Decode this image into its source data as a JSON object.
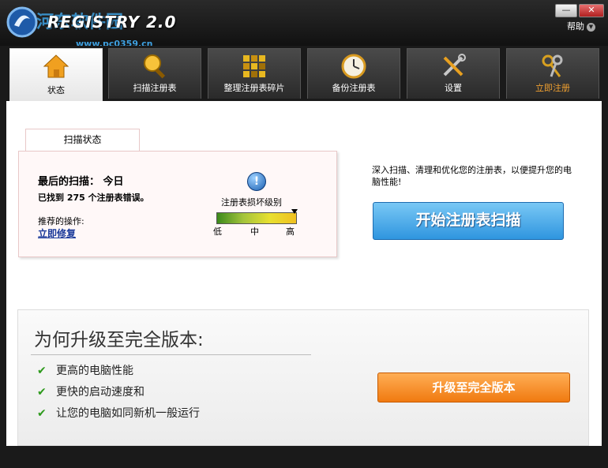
{
  "window": {
    "logo_text": "REGISTRY 2.0",
    "watermark": "河东软件园",
    "watermark_url": "www.pc0359.cn",
    "minimize_label": "—",
    "close_label": "✕",
    "help_label": "帮助"
  },
  "tabs": [
    {
      "label": "状态",
      "icon": "home-icon"
    },
    {
      "label": "扫描注册表",
      "icon": "magnifier-icon"
    },
    {
      "label": "整理注册表碎片",
      "icon": "defrag-icon"
    },
    {
      "label": "备份注册表",
      "icon": "clock-icon"
    },
    {
      "label": "设置",
      "icon": "tools-icon"
    },
    {
      "label": "立即注册",
      "icon": "keys-icon"
    }
  ],
  "status": {
    "tab_label": "扫描状态",
    "last_scan": "最后的扫描：  今日",
    "found_prefix": "已找到",
    "found_count": "275",
    "found_suffix": "个注册表错误。",
    "recommend_label": "推荐的操作:",
    "fix_link": "立即修复",
    "info_icon_glyph": "!",
    "damage_label": "注册表损坏级别",
    "damage_level": 0.98,
    "meter_low": "低",
    "meter_mid": "中",
    "meter_high": "高"
  },
  "scan": {
    "description": "深入扫描、清理和优化您的注册表，以便提升您的电脑性能!",
    "button_label": "开始注册表扫描"
  },
  "upgrade": {
    "title": "为何升级至完全版本:",
    "benefits": [
      "更高的电脑性能",
      "更快的启动速度和",
      "让您的电脑如同新机一般运行"
    ],
    "button_label": "升级至完全版本"
  },
  "colors": {
    "scan_button": "#2f95df",
    "upgrade_button": "#f07a10",
    "register_tab_text": "#f0a030",
    "check_green": "#2d9a1c"
  }
}
